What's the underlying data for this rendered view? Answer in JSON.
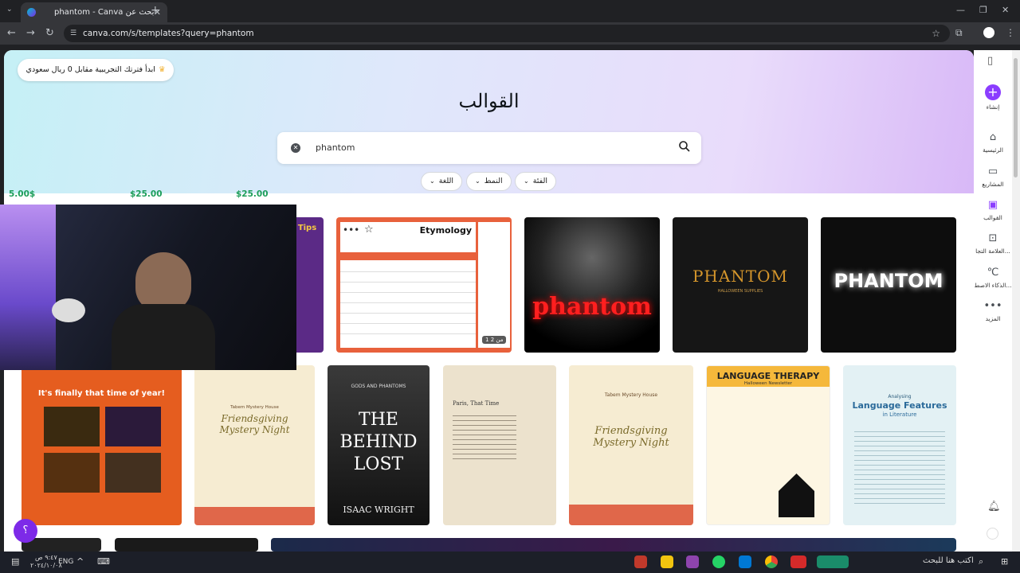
{
  "browser": {
    "tab_title": "بحث عن phantom - Canva",
    "url": "canva.com/s/templates?query=phantom"
  },
  "hero": {
    "trial_text": "ابدأ فترتك التجريبية مقابل 0 ريال سعودي",
    "title": "القوالب",
    "search_value": "phantom"
  },
  "filters": [
    "الفئة",
    "النمط",
    "اللغة"
  ],
  "prices": [
    "5.00$",
    "$25.00",
    "$25.00"
  ],
  "results_row1": [
    {
      "label": "Tips"
    },
    {
      "title": "Etymology",
      "page_badge": "1 من 2"
    },
    {
      "title": "phantom"
    },
    {
      "title": "PHANTOM",
      "subtitle": "HALLOWEEN SUPPLIES"
    },
    {
      "title": "PHANTOM"
    }
  ],
  "results_row2": [
    {
      "title": "It's finally that time of year!"
    },
    {
      "title": "Friendsgiving Mystery Night",
      "header": "Tabem Mystery House"
    },
    {
      "title": "THE BEHIND LOST",
      "header": "GODS AND PHANTOMS",
      "author": "ISAAC WRIGHT"
    },
    {
      "title": "Paris, That Time"
    },
    {
      "title": "Friendsgiving Mystery Night",
      "header": "Tabem Mystery House"
    },
    {
      "title": "LANGUAGE THERAPY",
      "subtitle": "Halloween Newsletter"
    },
    {
      "title": "Language Features",
      "header": "Analysing",
      "subtitle": "in Literature"
    }
  ],
  "sidebar": [
    {
      "label": "إنشاء"
    },
    {
      "label": "الرئيسية"
    },
    {
      "label": "المشاريع"
    },
    {
      "label": "القوالب"
    },
    {
      "label": "العلامة التجا..."
    },
    {
      "label": "الذكاء الاصط..."
    },
    {
      "label": "المزيد"
    }
  ],
  "help_label": "؟",
  "taskbar": {
    "search_text": "اكتب هنا للبحث",
    "language": "ENG",
    "time": "٩:٤٧ ص",
    "date": "٢٠٢٤/١٠/٠٨"
  },
  "colors": {
    "brand_purple": "#8b3dff",
    "price_green": "#1e9e5a"
  }
}
